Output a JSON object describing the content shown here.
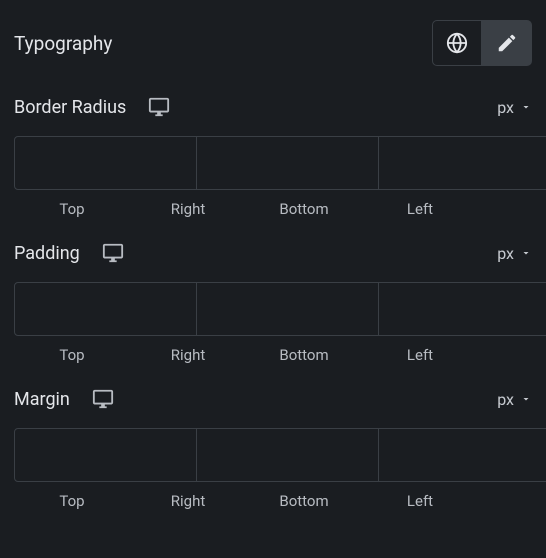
{
  "section": {
    "title": "Typography"
  },
  "controls": [
    {
      "label": "Border Radius",
      "unit": "px",
      "sides": [
        "Top",
        "Right",
        "Bottom",
        "Left"
      ],
      "values": [
        "",
        "",
        "",
        ""
      ]
    },
    {
      "label": "Padding",
      "unit": "px",
      "sides": [
        "Top",
        "Right",
        "Bottom",
        "Left"
      ],
      "values": [
        "",
        "",
        "",
        ""
      ]
    },
    {
      "label": "Margin",
      "unit": "px",
      "sides": [
        "Top",
        "Right",
        "Bottom",
        "Left"
      ],
      "values": [
        "",
        "",
        "",
        ""
      ]
    }
  ]
}
